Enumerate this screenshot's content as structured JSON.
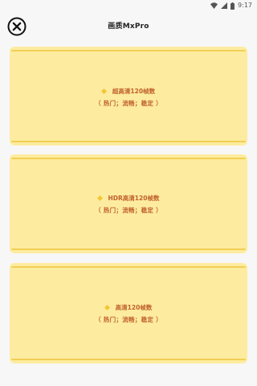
{
  "status_bar": {
    "time": "9:17",
    "icons": [
      "wifi-icon",
      "signal-icon",
      "battery-icon"
    ]
  },
  "header": {
    "title": "画质MxPro",
    "close_icon": "close-icon"
  },
  "cards": [
    {
      "title": "超高清120帧数",
      "subtitle": "（ 热门；流畅；稳定 ）"
    },
    {
      "title": "HDR高清120帧数",
      "subtitle": "（ 热门；流畅；稳定 ）"
    },
    {
      "title": "高清120帧数",
      "subtitle": "（ 热门；流畅；稳定 ）"
    }
  ],
  "colors": {
    "card_background": "#fdeca0",
    "card_line": "#f2cf54",
    "card_text": "#c0602a",
    "diamond": "#f4c535",
    "page_background": "#f7f7f7"
  }
}
